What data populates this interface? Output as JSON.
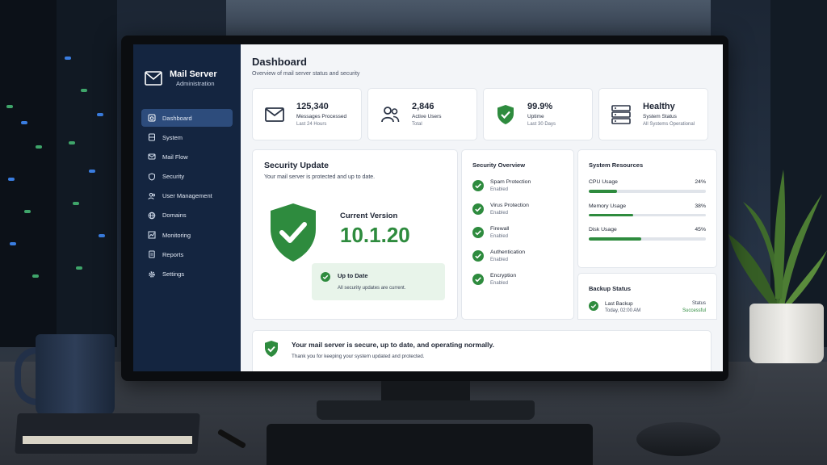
{
  "app": {
    "title": "Mail Server",
    "subtitle": "Administration"
  },
  "sidebar": {
    "items": [
      {
        "label": "Dashboard",
        "icon": "dashboard-icon",
        "active": true
      },
      {
        "label": "System",
        "icon": "server-icon",
        "active": false
      },
      {
        "label": "Mail Flow",
        "icon": "mail-icon",
        "active": false
      },
      {
        "label": "Security",
        "icon": "shield-icon",
        "active": false
      },
      {
        "label": "User Management",
        "icon": "users-icon",
        "active": false
      },
      {
        "label": "Domains",
        "icon": "globe-icon",
        "active": false
      },
      {
        "label": "Monitoring",
        "icon": "chart-icon",
        "active": false
      },
      {
        "label": "Reports",
        "icon": "report-icon",
        "active": false
      },
      {
        "label": "Settings",
        "icon": "gear-icon",
        "active": false
      }
    ]
  },
  "header": {
    "title": "Dashboard",
    "subtitle": "Overview of mail server status and security"
  },
  "stats": [
    {
      "value": "125,340",
      "label": "Messages Processed",
      "sub": "Last 24 Hours",
      "icon": "envelope-icon"
    },
    {
      "value": "2,846",
      "label": "Active Users",
      "sub": "Total",
      "icon": "users-icon"
    },
    {
      "value": "99.9%",
      "label": "Uptime",
      "sub": "Last 30 Days",
      "icon": "shield-check-icon"
    },
    {
      "value": "Healthy",
      "label": "System Status",
      "sub": "All Systems Operational",
      "icon": "server-icon"
    }
  ],
  "security_update": {
    "title": "Security Update",
    "message": "Your mail server is protected and up to date.",
    "version_label": "Current Version",
    "version": "10.1.20",
    "status_title": "Up to Date",
    "status_message": "All security updates are current."
  },
  "security_overview": {
    "title": "Security Overview",
    "items": [
      {
        "name": "Spam Protection",
        "status": "Enabled"
      },
      {
        "name": "Virus Protection",
        "status": "Enabled"
      },
      {
        "name": "Firewall",
        "status": "Enabled"
      },
      {
        "name": "Authentication",
        "status": "Enabled"
      },
      {
        "name": "Encryption",
        "status": "Enabled"
      }
    ]
  },
  "resources": {
    "title": "System Resources",
    "items": [
      {
        "name": "CPU Usage",
        "value": "24%",
        "percent": 24
      },
      {
        "name": "Memory Usage",
        "value": "38%",
        "percent": 38
      },
      {
        "name": "Disk Usage",
        "value": "45%",
        "percent": 45
      }
    ]
  },
  "backup": {
    "title": "Backup Status",
    "label": "Last Backup",
    "time": "Today, 02:00 AM",
    "status_label": "Status",
    "status_value": "Successful"
  },
  "banner": {
    "title": "Your mail server is secure, up to date, and operating normally.",
    "message": "Thank you for keeping your system updated and protected."
  },
  "colors": {
    "sidebar": "#142540",
    "active_item": "#2d4c7c",
    "success": "#2e8b3e"
  }
}
